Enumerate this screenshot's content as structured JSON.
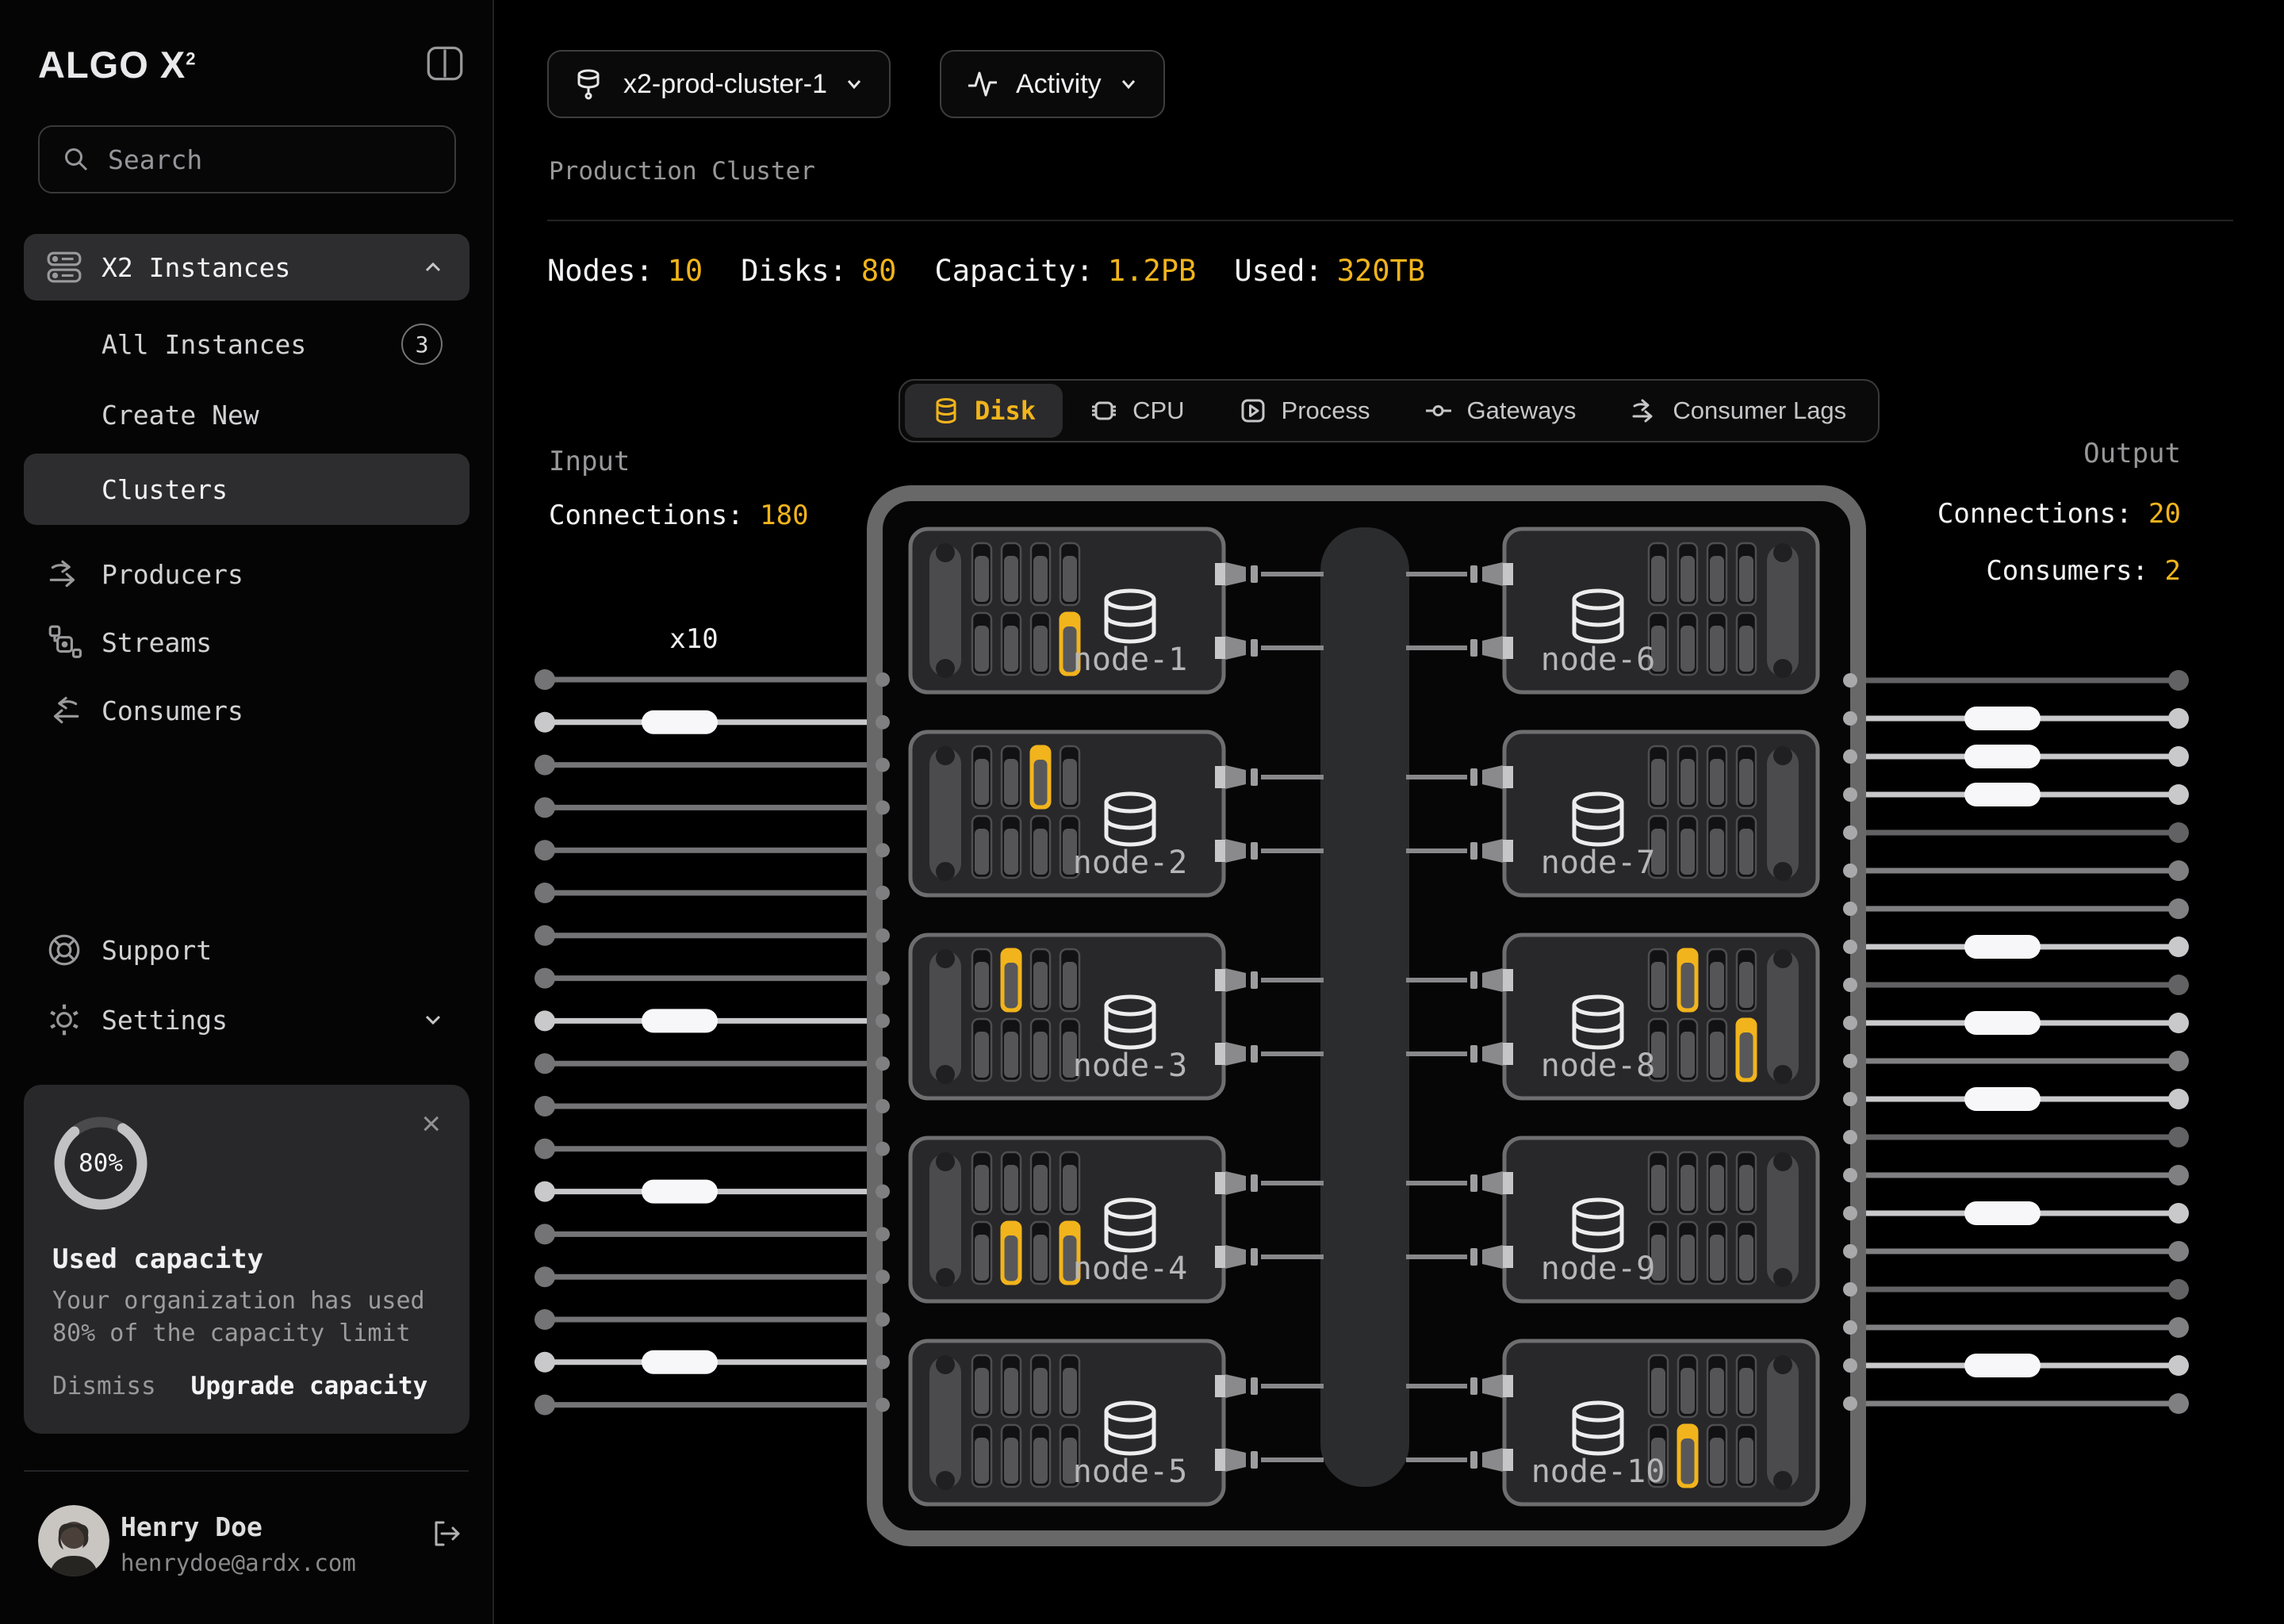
{
  "app": {
    "logo_text": "ALGO",
    "logo_mark": "X",
    "logo_sup": "2"
  },
  "sidebar": {
    "search_placeholder": "Search",
    "x2_instances": "X2 Instances",
    "all_instances": "All Instances",
    "all_instances_badge": "3",
    "create_new": "Create New",
    "clusters": "Clusters",
    "producers": "Producers",
    "streams": "Streams",
    "consumers": "Consumers",
    "support": "Support",
    "settings": "Settings",
    "capacity_card": {
      "percent_label": "80%",
      "percent_value": 80,
      "title": "Used capacity",
      "body": "Your organization has used 80% of the capacity limit",
      "dismiss": "Dismiss",
      "upgrade": "Upgrade capacity",
      "close": "×"
    },
    "user": {
      "name": "Henry Doe",
      "email": "henrydoe@ardx.com"
    }
  },
  "header": {
    "cluster_selector": "x2-prod-cluster-1",
    "activity_selector": "Activity",
    "subtitle": "Production Cluster",
    "stats": [
      {
        "label": "Nodes:",
        "value": "10"
      },
      {
        "label": "Disks:",
        "value": "80"
      },
      {
        "label": "Capacity:",
        "value": "1.2PB"
      },
      {
        "label": "Used:",
        "value": "320TB"
      }
    ]
  },
  "tabs": [
    {
      "label": "Disk",
      "active": true
    },
    {
      "label": "CPU",
      "active": false
    },
    {
      "label": "Process",
      "active": false
    },
    {
      "label": "Gateways",
      "active": false
    },
    {
      "label": "Consumer Lags",
      "active": false
    }
  ],
  "diagram": {
    "input": {
      "title": "Input",
      "connections_label": "Connections:",
      "connections_value": "180",
      "multiplier": "x10",
      "line_count": 18,
      "slider_lines": [
        1,
        8,
        12,
        16
      ]
    },
    "output": {
      "title": "Output",
      "connections_label": "Connections:",
      "connections_value": "20",
      "consumers_label": "Consumers:",
      "consumers_value": "2",
      "line_count": 20,
      "slider_lines": [
        1,
        2,
        3,
        7,
        9,
        11,
        14,
        18
      ]
    },
    "nodes": [
      {
        "name": "node-1",
        "side": "left",
        "hot_disks": [
          [
            1,
            3
          ]
        ]
      },
      {
        "name": "node-2",
        "side": "left",
        "hot_disks": [
          [
            0,
            2
          ]
        ]
      },
      {
        "name": "node-3",
        "side": "left",
        "hot_disks": [
          [
            0,
            1
          ]
        ]
      },
      {
        "name": "node-4",
        "side": "left",
        "hot_disks": [
          [
            1,
            1
          ],
          [
            1,
            3
          ]
        ]
      },
      {
        "name": "node-5",
        "side": "left",
        "hot_disks": []
      },
      {
        "name": "node-6",
        "side": "right",
        "hot_disks": []
      },
      {
        "name": "node-7",
        "side": "right",
        "hot_disks": []
      },
      {
        "name": "node-8",
        "side": "right",
        "hot_disks": [
          [
            0,
            1
          ],
          [
            1,
            3
          ]
        ]
      },
      {
        "name": "node-9",
        "side": "right",
        "hot_disks": []
      },
      {
        "name": "node-10",
        "side": "right",
        "hot_disks": [
          [
            1,
            1
          ]
        ]
      }
    ]
  },
  "colors": {
    "accent": "#f2b41c",
    "line_bright": "#c9c9cb",
    "line_mid": "#808082",
    "line_input": "#747476",
    "line_dim": "#626264",
    "handle": "#f7f7f9",
    "node_fill": "#28282a",
    "node_stroke": "#6e6e70",
    "container_stroke": "#686868",
    "bus_fill": "#2b2c2e"
  }
}
